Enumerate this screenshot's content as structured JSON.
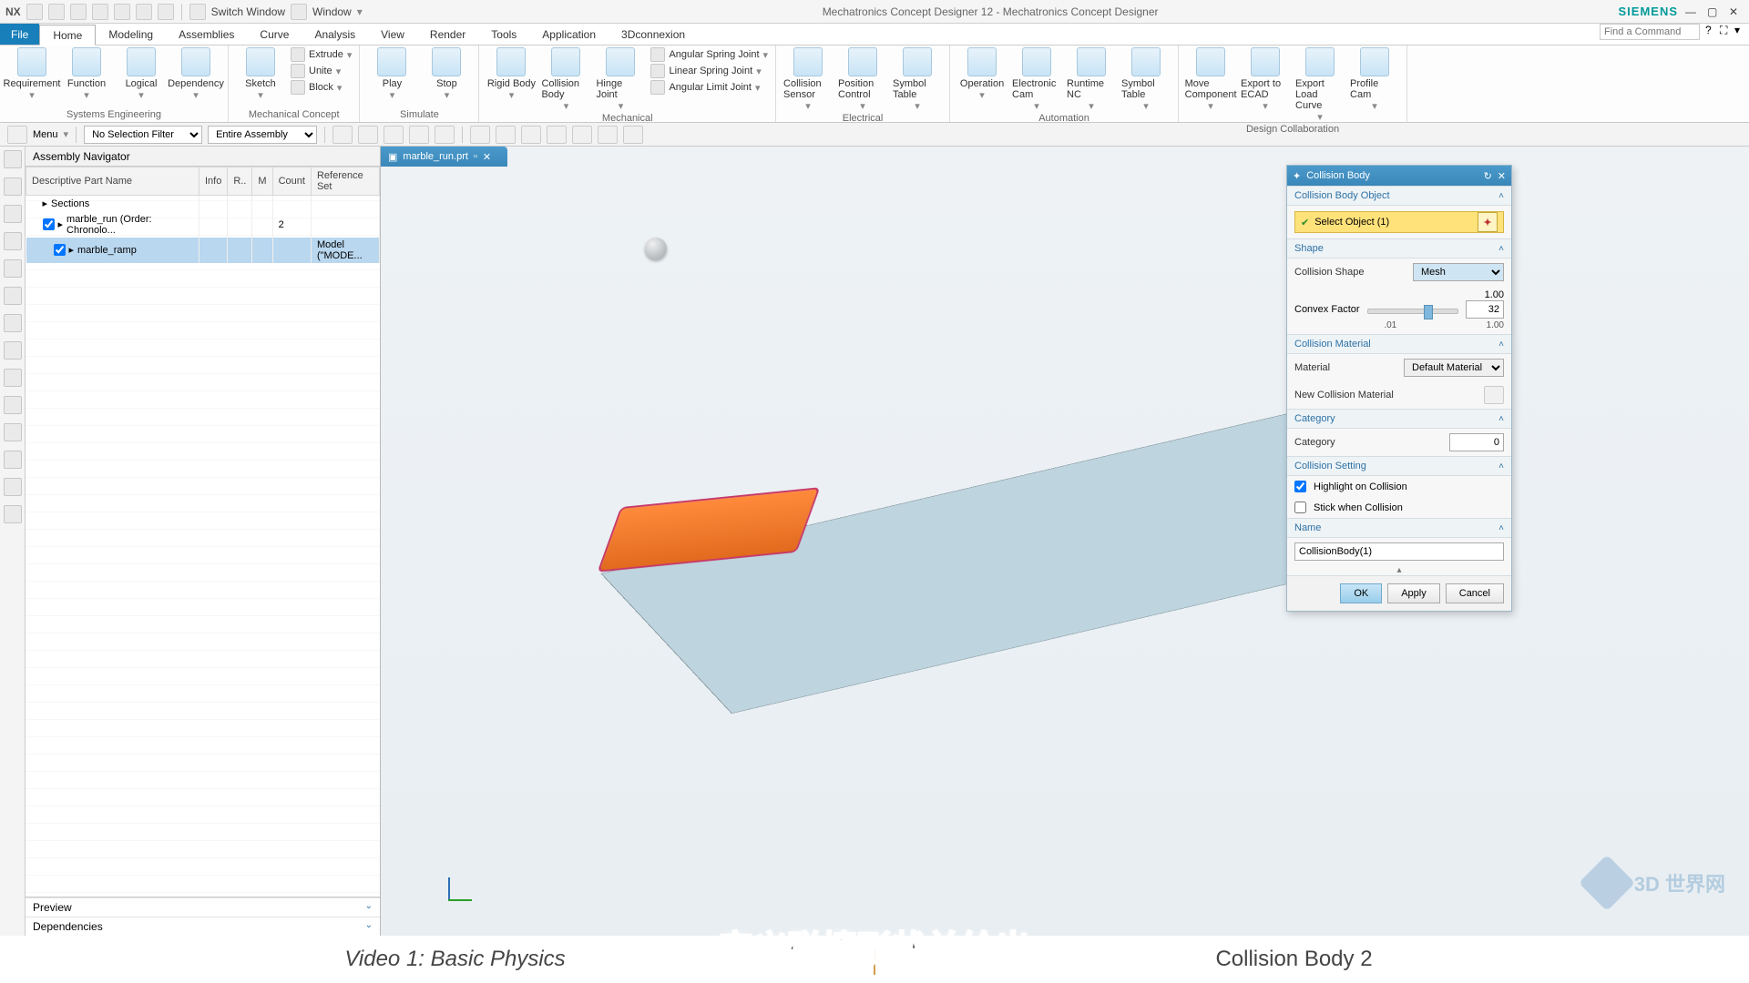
{
  "app": {
    "product": "NX",
    "title": "Mechatronics Concept Designer 12 - Mechatronics Concept Designer",
    "brand": "SIEMENS",
    "switch_window": "Switch Window",
    "window": "Window"
  },
  "menu": {
    "file": "File",
    "tabs": [
      "Home",
      "Modeling",
      "Assemblies",
      "Curve",
      "Analysis",
      "View",
      "Render",
      "Tools",
      "Application",
      "3Dconnexion"
    ],
    "active": "Home",
    "search_placeholder": "Find a Command"
  },
  "ribbon": {
    "groups": [
      {
        "label": "Systems Engineering",
        "big": [
          "Requirement",
          "Function",
          "Logical",
          "Dependency"
        ],
        "small": []
      },
      {
        "label": "Mechanical Concept",
        "big": [
          "Sketch"
        ],
        "small": [
          "Extrude",
          "Unite",
          "Block"
        ]
      },
      {
        "label": "Simulate",
        "big": [
          "Play",
          "Stop"
        ],
        "small": []
      },
      {
        "label": "Mechanical",
        "big": [
          "Rigid Body",
          "Collision Body",
          "Hinge Joint"
        ],
        "small": [
          "Angular Spring Joint",
          "Linear Spring Joint",
          "Angular Limit Joint"
        ]
      },
      {
        "label": "Electrical",
        "big": [
          "Collision Sensor",
          "Position Control",
          "Symbol Table"
        ],
        "small": []
      },
      {
        "label": "Automation",
        "big": [
          "Operation",
          "Electronic Cam",
          "Runtime NC",
          "Symbol Table"
        ],
        "small": []
      },
      {
        "label": "Design Collaboration",
        "big": [
          "Move Component",
          "Export to ECAD",
          "Export Load Curve",
          "Profile Cam"
        ],
        "small": []
      }
    ]
  },
  "toolbar": {
    "menu": "Menu",
    "filter": "No Selection Filter",
    "scope": "Entire Assembly"
  },
  "navigator": {
    "title": "Assembly Navigator",
    "columns": [
      "Descriptive Part Name",
      "Info",
      "R..",
      "M",
      "Count",
      "Reference Set"
    ],
    "rows": [
      {
        "name": "Sections",
        "indent": 1,
        "count": "",
        "ref": ""
      },
      {
        "name": "marble_run (Order: Chronolo...",
        "indent": 1,
        "count": "2",
        "ref": "",
        "checked": true
      },
      {
        "name": "marble_ramp",
        "indent": 2,
        "count": "",
        "ref": "Model (\"MODE...",
        "checked": true,
        "selected": true
      }
    ],
    "preview": "Preview",
    "dependencies": "Dependencies"
  },
  "viewtab": "marble_run.prt",
  "dialog": {
    "title": "Collision Body",
    "s_object": "Collision Body Object",
    "select_object": "Select Object (1)",
    "s_shape": "Shape",
    "collision_shape": "Collision Shape",
    "collision_shape_val": "Mesh",
    "convex_factor": "Convex Factor",
    "convex_top": "1.00",
    "convex_val": "32",
    "convex_min": ".01",
    "convex_max": "1.00",
    "s_material": "Collision Material",
    "material": "Material",
    "material_val": "Default Material",
    "new_material": "New Collision Material",
    "s_category": "Category",
    "category": "Category",
    "category_val": "0",
    "s_setting": "Collision Setting",
    "highlight": "Highlight on Collision",
    "stick": "Stick when Collision",
    "s_name": "Name",
    "name_val": "CollisionBody(1)",
    "ok": "OK",
    "apply": "Apply",
    "cancel": "Cancel"
  },
  "watermark": "3D 世界网",
  "bottom": {
    "left": "Video 1: Basic Physics",
    "right": "Collision Body 2"
  },
  "subtitle": "定义碰撞形状并给出"
}
